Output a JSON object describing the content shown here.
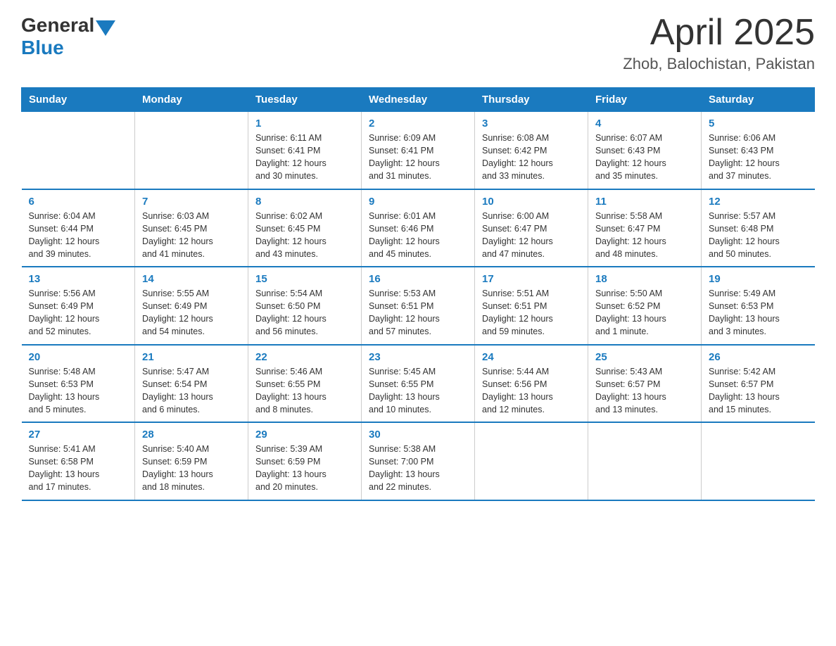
{
  "header": {
    "logo_general": "General",
    "logo_blue": "Blue",
    "month_title": "April 2025",
    "location": "Zhob, Balochistan, Pakistan"
  },
  "days_of_week": [
    "Sunday",
    "Monday",
    "Tuesday",
    "Wednesday",
    "Thursday",
    "Friday",
    "Saturday"
  ],
  "weeks": [
    [
      {
        "day": "",
        "info": ""
      },
      {
        "day": "",
        "info": ""
      },
      {
        "day": "1",
        "info": "Sunrise: 6:11 AM\nSunset: 6:41 PM\nDaylight: 12 hours\nand 30 minutes."
      },
      {
        "day": "2",
        "info": "Sunrise: 6:09 AM\nSunset: 6:41 PM\nDaylight: 12 hours\nand 31 minutes."
      },
      {
        "day": "3",
        "info": "Sunrise: 6:08 AM\nSunset: 6:42 PM\nDaylight: 12 hours\nand 33 minutes."
      },
      {
        "day": "4",
        "info": "Sunrise: 6:07 AM\nSunset: 6:43 PM\nDaylight: 12 hours\nand 35 minutes."
      },
      {
        "day": "5",
        "info": "Sunrise: 6:06 AM\nSunset: 6:43 PM\nDaylight: 12 hours\nand 37 minutes."
      }
    ],
    [
      {
        "day": "6",
        "info": "Sunrise: 6:04 AM\nSunset: 6:44 PM\nDaylight: 12 hours\nand 39 minutes."
      },
      {
        "day": "7",
        "info": "Sunrise: 6:03 AM\nSunset: 6:45 PM\nDaylight: 12 hours\nand 41 minutes."
      },
      {
        "day": "8",
        "info": "Sunrise: 6:02 AM\nSunset: 6:45 PM\nDaylight: 12 hours\nand 43 minutes."
      },
      {
        "day": "9",
        "info": "Sunrise: 6:01 AM\nSunset: 6:46 PM\nDaylight: 12 hours\nand 45 minutes."
      },
      {
        "day": "10",
        "info": "Sunrise: 6:00 AM\nSunset: 6:47 PM\nDaylight: 12 hours\nand 47 minutes."
      },
      {
        "day": "11",
        "info": "Sunrise: 5:58 AM\nSunset: 6:47 PM\nDaylight: 12 hours\nand 48 minutes."
      },
      {
        "day": "12",
        "info": "Sunrise: 5:57 AM\nSunset: 6:48 PM\nDaylight: 12 hours\nand 50 minutes."
      }
    ],
    [
      {
        "day": "13",
        "info": "Sunrise: 5:56 AM\nSunset: 6:49 PM\nDaylight: 12 hours\nand 52 minutes."
      },
      {
        "day": "14",
        "info": "Sunrise: 5:55 AM\nSunset: 6:49 PM\nDaylight: 12 hours\nand 54 minutes."
      },
      {
        "day": "15",
        "info": "Sunrise: 5:54 AM\nSunset: 6:50 PM\nDaylight: 12 hours\nand 56 minutes."
      },
      {
        "day": "16",
        "info": "Sunrise: 5:53 AM\nSunset: 6:51 PM\nDaylight: 12 hours\nand 57 minutes."
      },
      {
        "day": "17",
        "info": "Sunrise: 5:51 AM\nSunset: 6:51 PM\nDaylight: 12 hours\nand 59 minutes."
      },
      {
        "day": "18",
        "info": "Sunrise: 5:50 AM\nSunset: 6:52 PM\nDaylight: 13 hours\nand 1 minute."
      },
      {
        "day": "19",
        "info": "Sunrise: 5:49 AM\nSunset: 6:53 PM\nDaylight: 13 hours\nand 3 minutes."
      }
    ],
    [
      {
        "day": "20",
        "info": "Sunrise: 5:48 AM\nSunset: 6:53 PM\nDaylight: 13 hours\nand 5 minutes."
      },
      {
        "day": "21",
        "info": "Sunrise: 5:47 AM\nSunset: 6:54 PM\nDaylight: 13 hours\nand 6 minutes."
      },
      {
        "day": "22",
        "info": "Sunrise: 5:46 AM\nSunset: 6:55 PM\nDaylight: 13 hours\nand 8 minutes."
      },
      {
        "day": "23",
        "info": "Sunrise: 5:45 AM\nSunset: 6:55 PM\nDaylight: 13 hours\nand 10 minutes."
      },
      {
        "day": "24",
        "info": "Sunrise: 5:44 AM\nSunset: 6:56 PM\nDaylight: 13 hours\nand 12 minutes."
      },
      {
        "day": "25",
        "info": "Sunrise: 5:43 AM\nSunset: 6:57 PM\nDaylight: 13 hours\nand 13 minutes."
      },
      {
        "day": "26",
        "info": "Sunrise: 5:42 AM\nSunset: 6:57 PM\nDaylight: 13 hours\nand 15 minutes."
      }
    ],
    [
      {
        "day": "27",
        "info": "Sunrise: 5:41 AM\nSunset: 6:58 PM\nDaylight: 13 hours\nand 17 minutes."
      },
      {
        "day": "28",
        "info": "Sunrise: 5:40 AM\nSunset: 6:59 PM\nDaylight: 13 hours\nand 18 minutes."
      },
      {
        "day": "29",
        "info": "Sunrise: 5:39 AM\nSunset: 6:59 PM\nDaylight: 13 hours\nand 20 minutes."
      },
      {
        "day": "30",
        "info": "Sunrise: 5:38 AM\nSunset: 7:00 PM\nDaylight: 13 hours\nand 22 minutes."
      },
      {
        "day": "",
        "info": ""
      },
      {
        "day": "",
        "info": ""
      },
      {
        "day": "",
        "info": ""
      }
    ]
  ]
}
